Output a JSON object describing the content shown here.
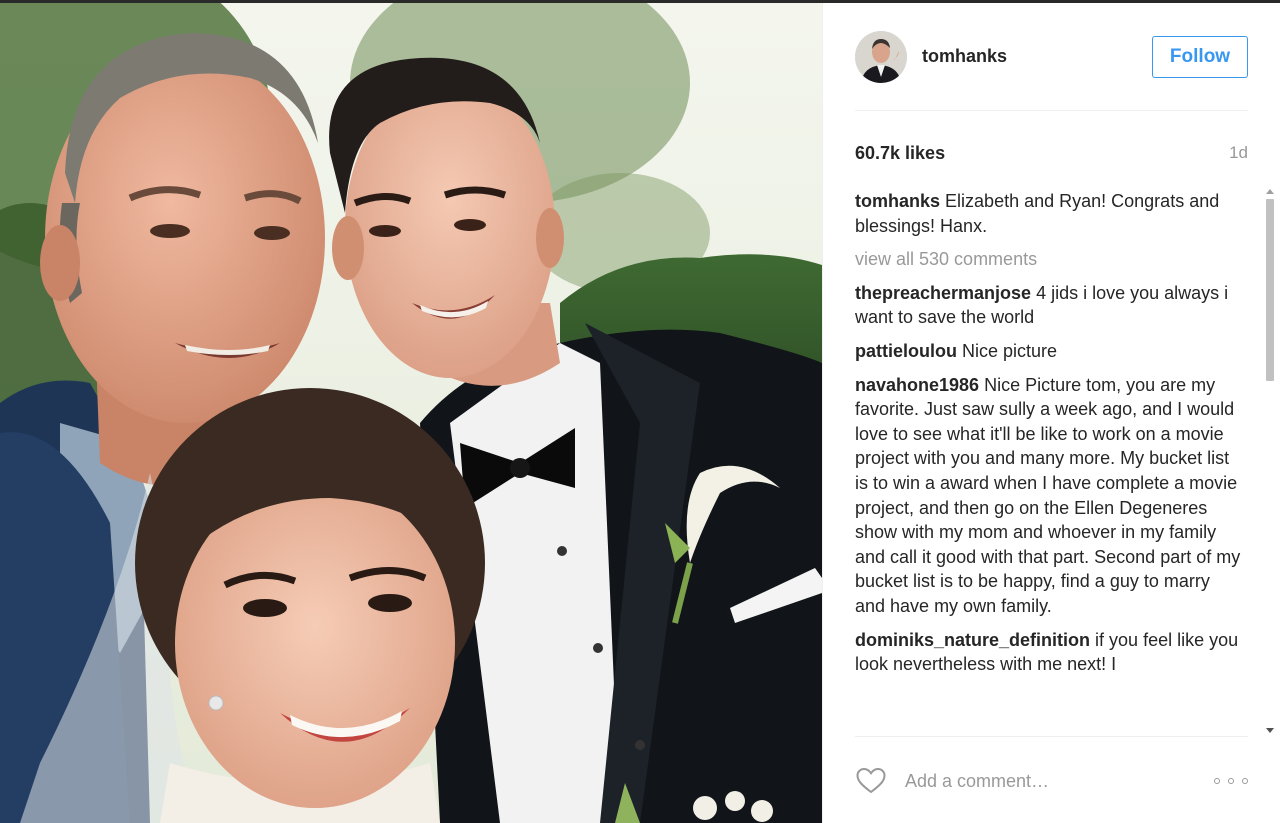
{
  "post": {
    "username": "tomhanks",
    "follow_label": "Follow",
    "likes": "60.7k likes",
    "age": "1d",
    "caption": {
      "author": "tomhanks",
      "text": "Elizabeth and Ryan! Congrats and blessings! Hanx."
    },
    "view_all_label": "view all 530 comments",
    "comments": [
      {
        "author": "thepreachermanjose",
        "text": "4 jids i love you always i want to save the world"
      },
      {
        "author": "pattieloulou",
        "text": "Nice picture"
      },
      {
        "author": "navahone1986",
        "text": "Nice Picture tom, you are my favorite. Just saw sully a week ago, and I would love to see what it'll be like to work on a movie project with you and many more. My bucket list is to win a award when I have complete a movie project, and then go on the Ellen Degeneres show with my mom and whoever in my family and call it good with that part. Second part of my bucket list is to be happy, find a guy to marry and have my own family."
      },
      {
        "author": "dominiks_nature_definition",
        "text": "if you feel like you look nevertheless with me next! I"
      }
    ],
    "comment_placeholder": "Add a comment…"
  },
  "colors": {
    "accent": "#3897f0",
    "text": "#262626",
    "muted": "#999999",
    "divider": "#efefef"
  },
  "icons": {
    "like": "heart-outline-icon",
    "more": "more-options-icon"
  }
}
